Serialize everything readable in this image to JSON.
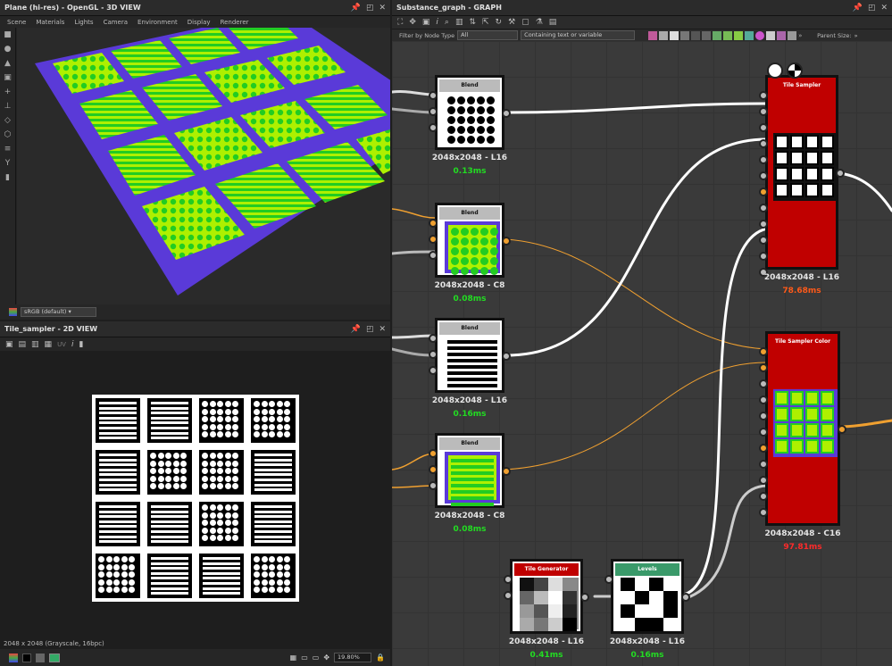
{
  "panel3d": {
    "title": "Plane (hi-res) - OpenGL - 3D VIEW",
    "menu": [
      "Scene",
      "Materials",
      "Lights",
      "Camera",
      "Environment",
      "Display",
      "Renderer"
    ],
    "colorspace": "sRGB (default)"
  },
  "panel2d": {
    "title": "Tile_sampler - 2D VIEW",
    "uv_label": "UV",
    "status": "2048 x 2048 (Grayscale, 16bpc)",
    "zoom": "19.80%",
    "grid": [
      [
        "lines",
        "lines",
        "dots",
        "dots"
      ],
      [
        "lines",
        "dots",
        "dots",
        "lines"
      ],
      [
        "lines",
        "lines",
        "dots",
        "lines"
      ],
      [
        "dots",
        "lines",
        "lines",
        "dots"
      ]
    ]
  },
  "graph": {
    "title": "Substance_graph - GRAPH",
    "filter_label": "Filter by Node Type",
    "filter_value": "All",
    "text_filter_placeholder": "Containing text or variable",
    "parent_size_label": "Parent Size:",
    "nodes": [
      {
        "id": "blend1",
        "title": "Blend",
        "res": "2048x2048 - L16",
        "time": "0.13ms"
      },
      {
        "id": "blend2",
        "title": "Blend",
        "res": "2048x2048 - C8",
        "time": "0.08ms"
      },
      {
        "id": "blend3",
        "title": "Blend",
        "res": "2048x2048 - L16",
        "time": "0.16ms"
      },
      {
        "id": "blend4",
        "title": "Blend",
        "res": "2048x2048 - C8",
        "time": "0.08ms"
      },
      {
        "id": "tilesampler",
        "title": "Tile Sampler",
        "res": "2048x2048 - L16",
        "time": "78.68ms"
      },
      {
        "id": "tilesamplercolor",
        "title": "Tile Sampler Color",
        "res": "2048x2048 - C16",
        "time": "97.81ms"
      },
      {
        "id": "tilegen",
        "title": "Tile Generator",
        "res": "2048x2048 - L16",
        "time": "0.41ms"
      },
      {
        "id": "levels",
        "title": "Levels",
        "res": "2048x2048 - L16",
        "time": "0.16ms"
      }
    ]
  },
  "colors": {
    "time_fast": "#22dd22",
    "time_slow_orange": "#ff5a1a",
    "time_slow_red": "#ff2a2a",
    "tile_sampler_red": "#c00000",
    "levels_green": "#3a9a6a",
    "port_orange": "#f0a030"
  }
}
